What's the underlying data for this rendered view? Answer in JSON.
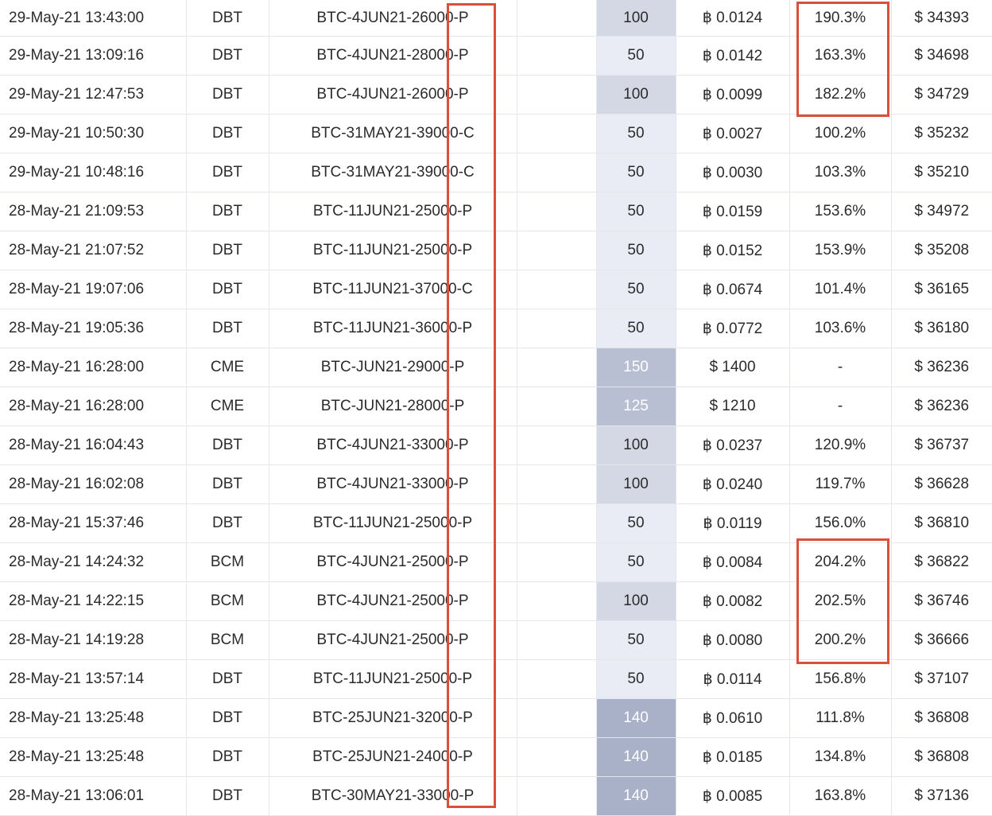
{
  "annotations": {
    "color": "#d9503b"
  },
  "size_shading": {
    "50": "tone-1",
    "100": "tone-2",
    "125": "tone-3",
    "150": "tone-3",
    "140": "tone-4"
  },
  "rows": [
    {
      "time": "29-May-21 13:43:00",
      "exchange": "DBT",
      "instrument": "BTC-4JUN21-26000-P",
      "size": "100",
      "price": "฿ 0.0124",
      "iv": "190.3%",
      "index": "$ 34393"
    },
    {
      "time": "29-May-21 13:09:16",
      "exchange": "DBT",
      "instrument": "BTC-4JUN21-28000-P",
      "size": "50",
      "price": "฿ 0.0142",
      "iv": "163.3%",
      "index": "$ 34698"
    },
    {
      "time": "29-May-21 12:47:53",
      "exchange": "DBT",
      "instrument": "BTC-4JUN21-26000-P",
      "size": "100",
      "price": "฿ 0.0099",
      "iv": "182.2%",
      "index": "$ 34729"
    },
    {
      "time": "29-May-21 10:50:30",
      "exchange": "DBT",
      "instrument": "BTC-31MAY21-39000-C",
      "size": "50",
      "price": "฿ 0.0027",
      "iv": "100.2%",
      "index": "$ 35232"
    },
    {
      "time": "29-May-21 10:48:16",
      "exchange": "DBT",
      "instrument": "BTC-31MAY21-39000-C",
      "size": "50",
      "price": "฿ 0.0030",
      "iv": "103.3%",
      "index": "$ 35210"
    },
    {
      "time": "28-May-21 21:09:53",
      "exchange": "DBT",
      "instrument": "BTC-11JUN21-25000-P",
      "size": "50",
      "price": "฿ 0.0159",
      "iv": "153.6%",
      "index": "$ 34972"
    },
    {
      "time": "28-May-21 21:07:52",
      "exchange": "DBT",
      "instrument": "BTC-11JUN21-25000-P",
      "size": "50",
      "price": "฿ 0.0152",
      "iv": "153.9%",
      "index": "$ 35208"
    },
    {
      "time": "28-May-21 19:07:06",
      "exchange": "DBT",
      "instrument": "BTC-11JUN21-37000-C",
      "size": "50",
      "price": "฿ 0.0674",
      "iv": "101.4%",
      "index": "$ 36165"
    },
    {
      "time": "28-May-21 19:05:36",
      "exchange": "DBT",
      "instrument": "BTC-11JUN21-36000-P",
      "size": "50",
      "price": "฿ 0.0772",
      "iv": "103.6%",
      "index": "$ 36180"
    },
    {
      "time": "28-May-21 16:28:00",
      "exchange": "CME",
      "instrument": "BTC-JUN21-29000-P",
      "size": "150",
      "price": "$ 1400",
      "iv": "-",
      "index": "$ 36236"
    },
    {
      "time": "28-May-21 16:28:00",
      "exchange": "CME",
      "instrument": "BTC-JUN21-28000-P",
      "size": "125",
      "price": "$ 1210",
      "iv": "-",
      "index": "$ 36236"
    },
    {
      "time": "28-May-21 16:04:43",
      "exchange": "DBT",
      "instrument": "BTC-4JUN21-33000-P",
      "size": "100",
      "price": "฿ 0.0237",
      "iv": "120.9%",
      "index": "$ 36737"
    },
    {
      "time": "28-May-21 16:02:08",
      "exchange": "DBT",
      "instrument": "BTC-4JUN21-33000-P",
      "size": "100",
      "price": "฿ 0.0240",
      "iv": "119.7%",
      "index": "$ 36628"
    },
    {
      "time": "28-May-21 15:37:46",
      "exchange": "DBT",
      "instrument": "BTC-11JUN21-25000-P",
      "size": "50",
      "price": "฿ 0.0119",
      "iv": "156.0%",
      "index": "$ 36810"
    },
    {
      "time": "28-May-21 14:24:32",
      "exchange": "BCM",
      "instrument": "BTC-4JUN21-25000-P",
      "size": "50",
      "price": "฿ 0.0084",
      "iv": "204.2%",
      "index": "$ 36822"
    },
    {
      "time": "28-May-21 14:22:15",
      "exchange": "BCM",
      "instrument": "BTC-4JUN21-25000-P",
      "size": "100",
      "price": "฿ 0.0082",
      "iv": "202.5%",
      "index": "$ 36746"
    },
    {
      "time": "28-May-21 14:19:28",
      "exchange": "BCM",
      "instrument": "BTC-4JUN21-25000-P",
      "size": "50",
      "price": "฿ 0.0080",
      "iv": "200.2%",
      "index": "$ 36666"
    },
    {
      "time": "28-May-21 13:57:14",
      "exchange": "DBT",
      "instrument": "BTC-11JUN21-25000-P",
      "size": "50",
      "price": "฿ 0.0114",
      "iv": "156.8%",
      "index": "$ 37107"
    },
    {
      "time": "28-May-21 13:25:48",
      "exchange": "DBT",
      "instrument": "BTC-25JUN21-32000-P",
      "size": "140",
      "price": "฿ 0.0610",
      "iv": "111.8%",
      "index": "$ 36808"
    },
    {
      "time": "28-May-21 13:25:48",
      "exchange": "DBT",
      "instrument": "BTC-25JUN21-24000-P",
      "size": "140",
      "price": "฿ 0.0185",
      "iv": "134.8%",
      "index": "$ 36808"
    },
    {
      "time": "28-May-21 13:06:01",
      "exchange": "DBT",
      "instrument": "BTC-30MAY21-33000-P",
      "size": "140",
      "price": "฿ 0.0085",
      "iv": "163.8%",
      "index": "$ 37136"
    }
  ]
}
